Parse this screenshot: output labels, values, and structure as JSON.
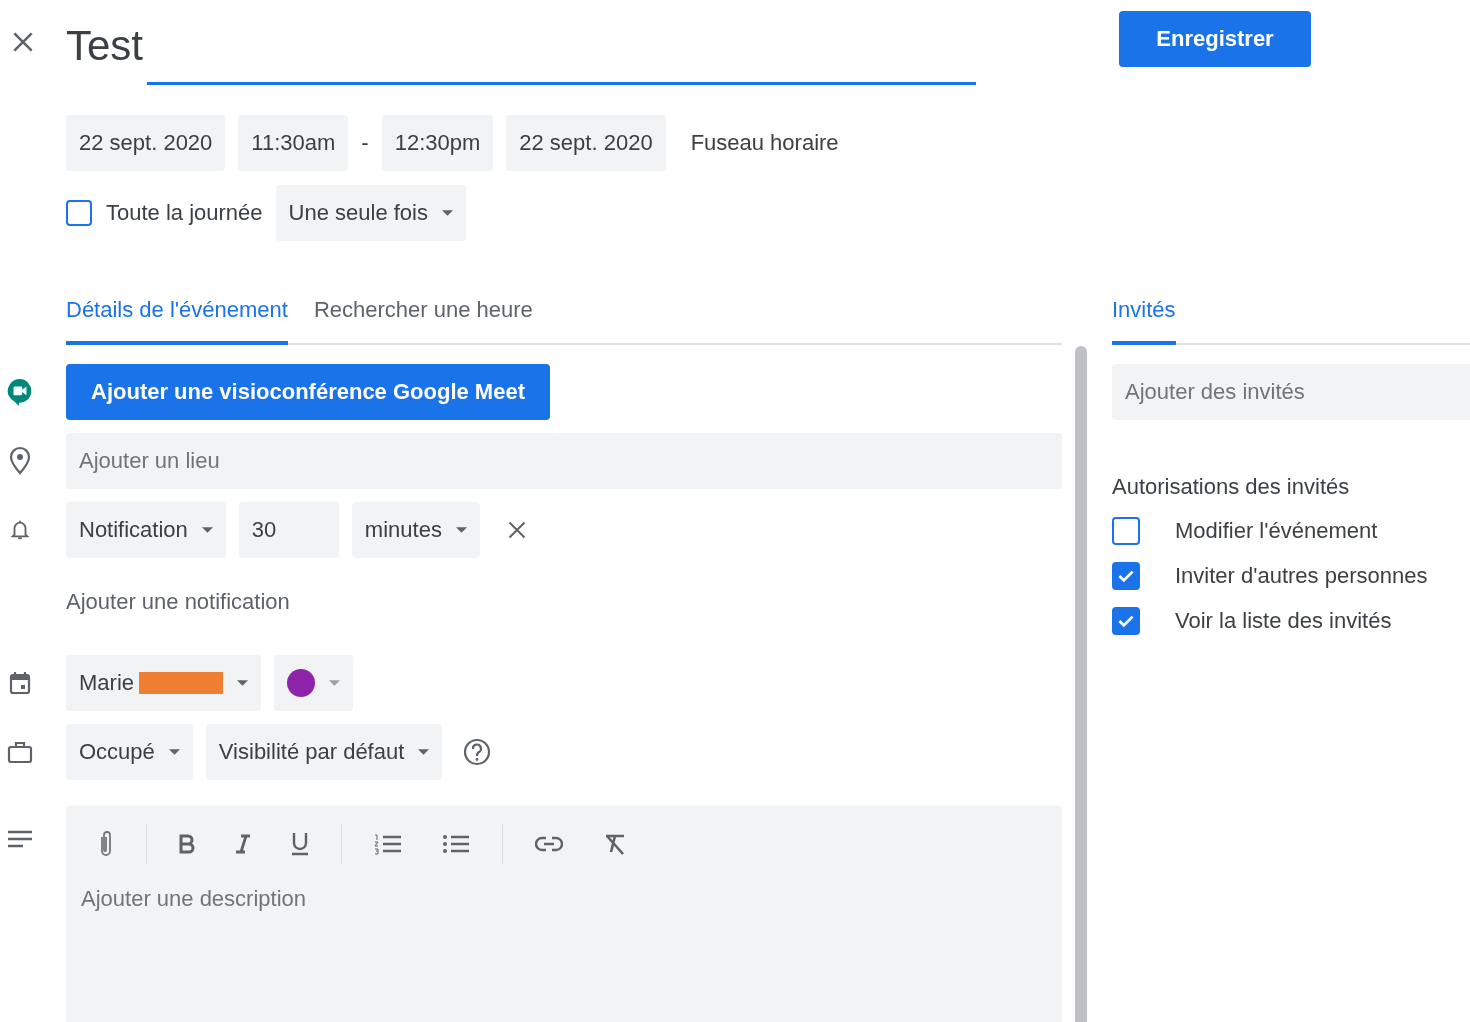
{
  "title": {
    "value": "Test"
  },
  "save_button": "Enregistrer",
  "date_row": {
    "start_date": "22 sept. 2020",
    "start_time": "11:30am",
    "separator": "-",
    "end_time": "12:30pm",
    "end_date": "22 sept. 2020",
    "timezone": "Fuseau horaire"
  },
  "all_day": {
    "label": "Toute la journée",
    "checked": false
  },
  "recurrence": "Une seule fois",
  "tabs": [
    {
      "label": "Détails de l'événement",
      "selected": true
    },
    {
      "label": "Rechercher une heure",
      "selected": false
    }
  ],
  "meet_button": "Ajouter une visioconférence Google Meet",
  "location": {
    "placeholder": "Ajouter un lieu"
  },
  "notification": {
    "type": "Notification",
    "value": "30",
    "unit": "minutes"
  },
  "add_notification": "Ajouter une notification",
  "calendar": {
    "owner": "Marie",
    "color": "#8e24aa"
  },
  "availability": "Occupé",
  "visibility": "Visibilité par défaut",
  "description": {
    "placeholder": "Ajouter une description"
  },
  "guests_tab": {
    "label": "Invités",
    "selected": true
  },
  "guest_input": {
    "placeholder": "Ajouter des invités"
  },
  "permissions": {
    "title": "Autorisations des invités",
    "items": [
      {
        "label": "Modifier l'événement",
        "checked": false
      },
      {
        "label": "Inviter d'autres personnes",
        "checked": true
      },
      {
        "label": "Voir la liste des invités",
        "checked": true
      }
    ]
  }
}
